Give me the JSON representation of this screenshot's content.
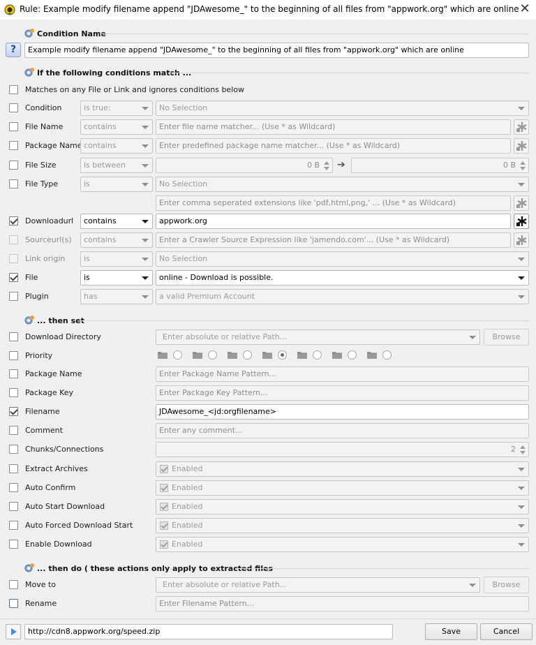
{
  "window": {
    "title": "Rule: Example modify filename append \"JDAwesome_\" to the beginning of all files from \"appwork.org\" which are online",
    "close_icon": "close-icon"
  },
  "condition_name": {
    "header": "Condition Name",
    "help_label": "?",
    "value": "Example modify filename append \"JDAwesome_\" to the beginning of all files from \"appwork.org\" which are online"
  },
  "conditions": {
    "header": "If the following conditions match ...",
    "match_any_label": "Matches on any File or Link and ignores conditions below",
    "condition": {
      "label": "Condition",
      "op": "is true:",
      "value": "No Selection"
    },
    "file_name": {
      "label": "File Name",
      "op": "contains",
      "placeholder": "Enter file name matcher... (Use * as Wildcard)"
    },
    "package_name": {
      "label": "Package Name",
      "op": "contains",
      "placeholder": "Enter predefined package name matcher... (Use * as Wildcard)"
    },
    "file_size": {
      "label": "File Size",
      "op": "is between",
      "from": "0 B",
      "to": "0 B"
    },
    "file_type": {
      "label": "File Type",
      "op": "is",
      "value": "No Selection",
      "extensions_placeholder": "Enter comma seperated extensions like 'pdf,html,png,' ... (Use * as Wildcard)"
    },
    "downloadurl": {
      "label": "Downloadurl",
      "op": "contains",
      "value": "appwork.org",
      "checked": true
    },
    "sourceurls": {
      "label": "Sourceurl(s)",
      "op": "contains",
      "placeholder": "Enter a Crawler Source Expression like 'jamendo.com'... (Use * as Wildcard)"
    },
    "link_origin": {
      "label": "Link origin",
      "op": "is",
      "value": "No Selection"
    },
    "file": {
      "label": "File",
      "op": "is",
      "value": "online - Download is possible.",
      "checked": true
    },
    "plugin": {
      "label": "Plugin",
      "op": "has",
      "value": "a valid Premium Account"
    }
  },
  "then_set": {
    "header": "... then set",
    "download_directory": {
      "label": "Download Directory",
      "placeholder": "Enter absolute or relative Path...",
      "browse": "Browse"
    },
    "priority": {
      "label": "Priority",
      "levels": [
        "lowest",
        "lower",
        "low",
        "default",
        "high",
        "higher",
        "highest"
      ],
      "selected_index": 3
    },
    "package_name": {
      "label": "Package Name",
      "placeholder": "Enter Package Name Pattern..."
    },
    "package_key": {
      "label": "Package Key",
      "placeholder": "Enter Package Key Pattern..."
    },
    "filename": {
      "label": "Filename",
      "value": "JDAwesome_<jd:orgfilename>",
      "checked": true
    },
    "comment": {
      "label": "Comment",
      "placeholder": "Enter any comment..."
    },
    "chunks": {
      "label": "Chunks/Connections",
      "value": "2"
    },
    "extract_archives": {
      "label": "Extract Archives",
      "value": "Enabled"
    },
    "auto_confirm": {
      "label": "Auto Confirm",
      "value": "Enabled"
    },
    "auto_start": {
      "label": "Auto Start Download",
      "value": "Enabled"
    },
    "auto_forced": {
      "label": "Auto Forced Download Start",
      "value": "Enabled"
    },
    "enable_download": {
      "label": "Enable Download",
      "value": "Enabled"
    }
  },
  "then_do": {
    "header": "... then do ( these actions only apply to extracted files",
    "move_to": {
      "label": "Move to",
      "placeholder": "Enter absolute or relative Path...",
      "browse": "Browse"
    },
    "rename": {
      "label": "Rename",
      "placeholder": "Enter Filename Pattern..."
    }
  },
  "footer": {
    "test_url": "http://cdn8.appwork.org/speed.zip",
    "save": "Save",
    "cancel": "Cancel"
  }
}
